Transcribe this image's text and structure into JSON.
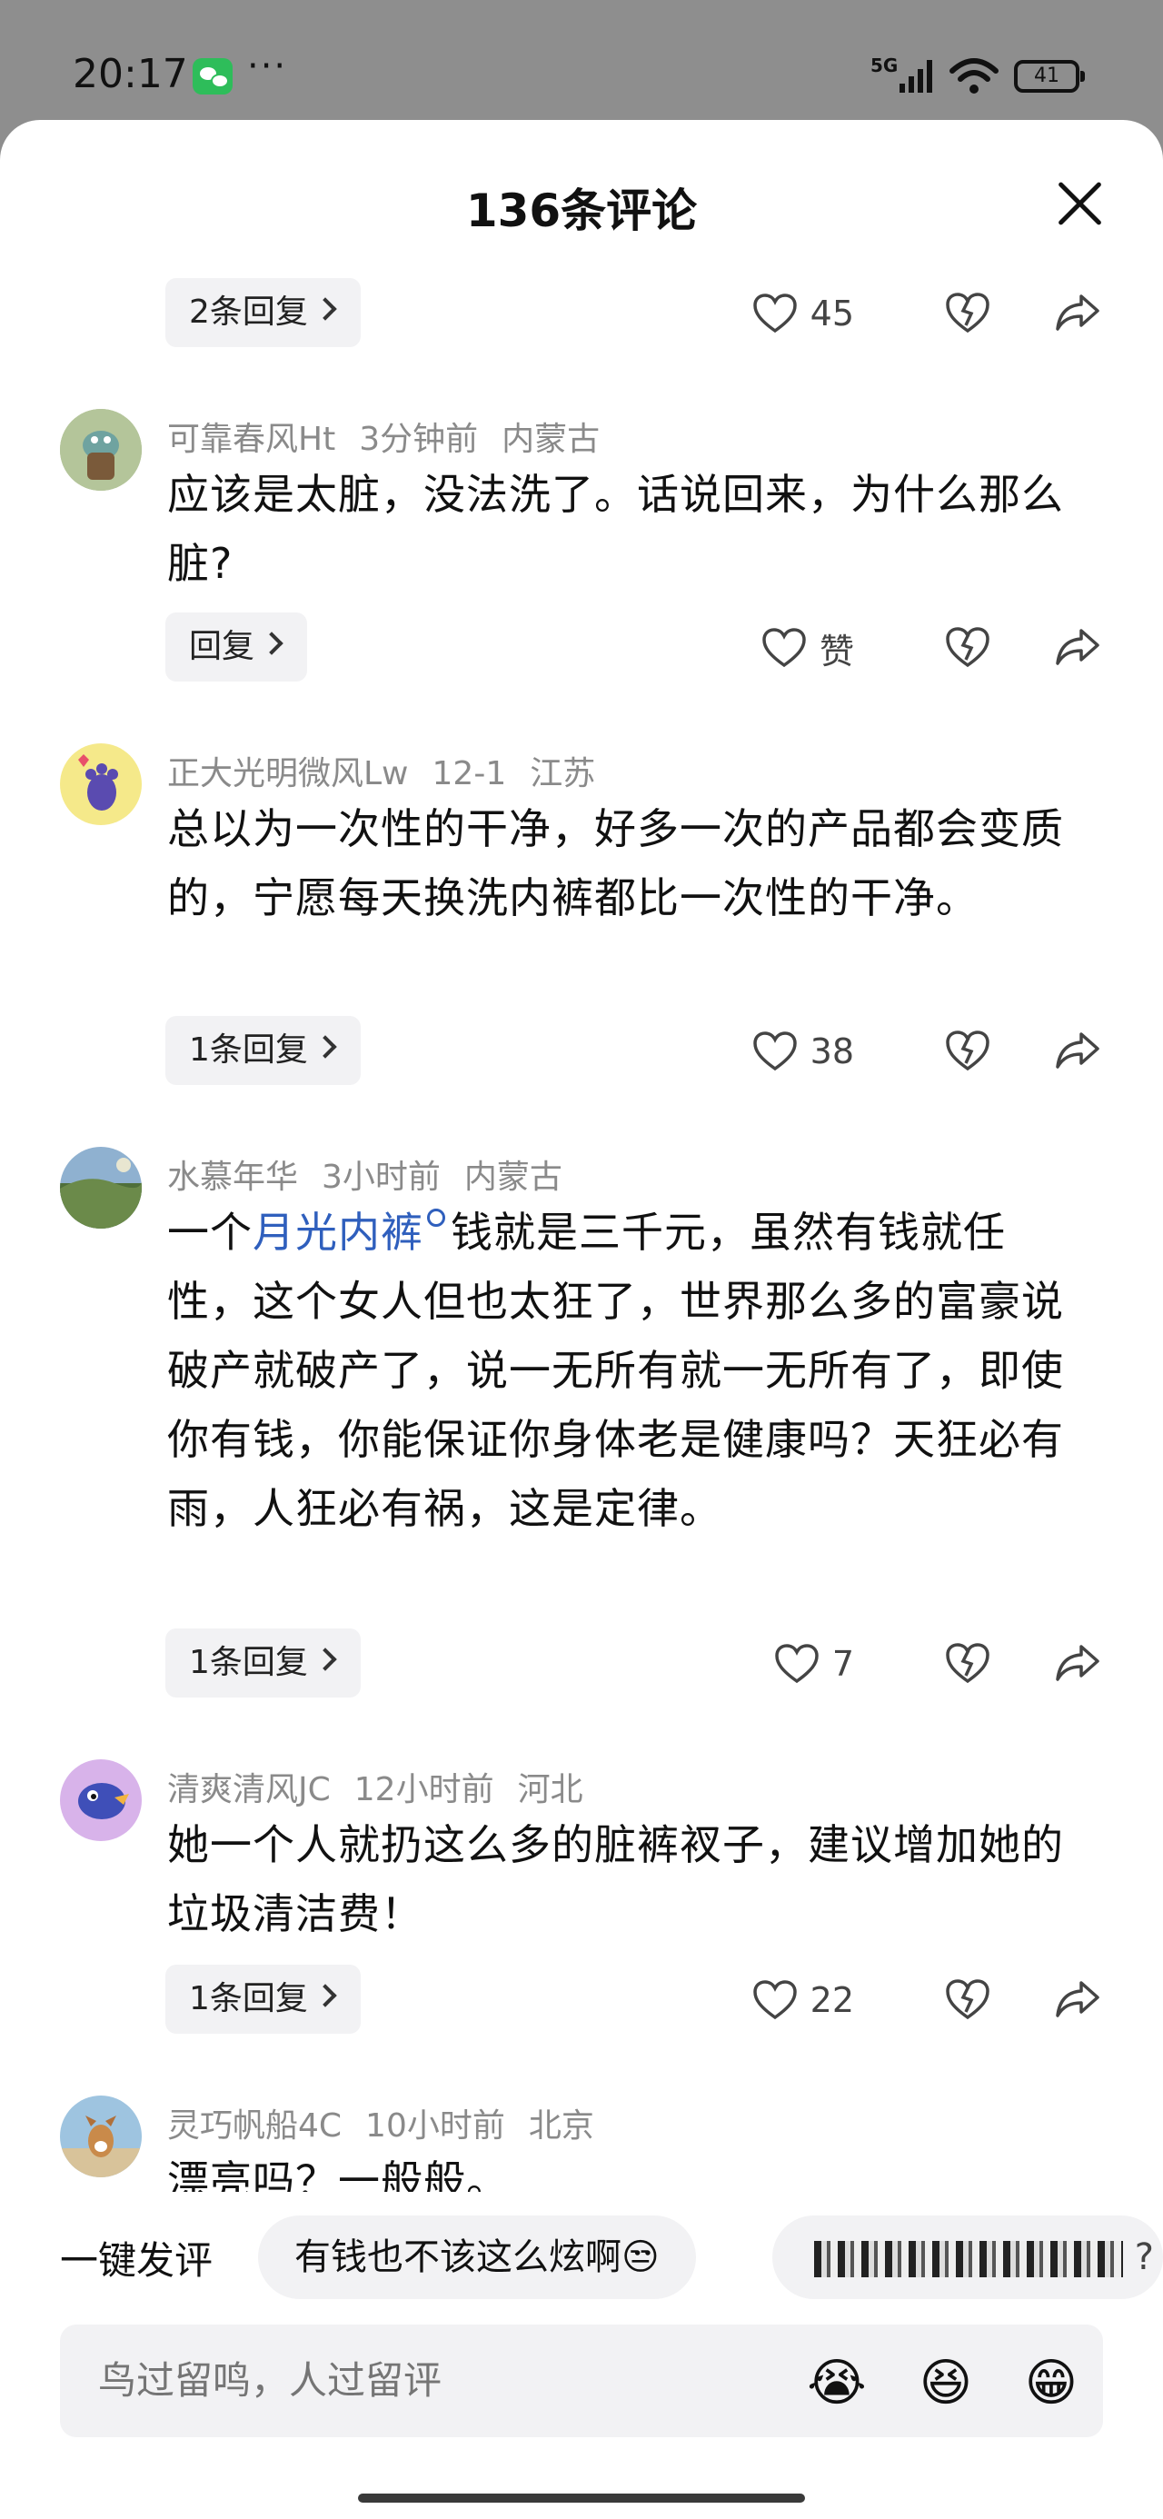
{
  "status_bar": {
    "time": "20:17",
    "dots": "···",
    "network": "5G",
    "battery": "41",
    "icons": [
      "wechat-icon",
      "signal-icon",
      "wifi-icon",
      "battery-icon"
    ]
  },
  "sheet": {
    "title": "136条评论",
    "close_icon": "close-icon"
  },
  "top_row": {
    "reply_label": "2条回复",
    "like_count": "45"
  },
  "comments": [
    {
      "user": "可靠春风Ht",
      "time": "3分钟前",
      "location": "内蒙古",
      "text": "应该是太脏，没法洗了。话说回来，为什么那么脏?",
      "reply_label": "回复",
      "like_count": "赞"
    },
    {
      "user": "正大光明微风Lw",
      "time": "12-1",
      "location": "江苏",
      "text": "总以为一次性的干净，好多一次的产品都会变质的，宁愿每天换洗内裤都比一次性的干净。",
      "reply_label": "1条回复",
      "like_count": "38"
    },
    {
      "user": "水慕年华",
      "time": "3小时前",
      "location": "内蒙古",
      "text_before": "一个",
      "link": "月光内裤",
      "text_after": "钱就是三千元，虽然有钱就任性，这个女人但也太狂了，世界那么多的富豪说破产就破产了，说一无所有就一无所有了，即使你有钱，你能保证你身体老是健康吗？天狂必有雨，人狂必有祸，这是定律。",
      "reply_label": "1条回复",
      "like_count": "7"
    },
    {
      "user": "清爽清风JC",
      "time": "12小时前",
      "location": "河北",
      "text": "她一个人就扔这么多的脏裤衩子，建议增加她的垃圾清洁费！",
      "reply_label": "1条回复",
      "like_count": "22"
    },
    {
      "user": "灵巧帆船4C",
      "time": "10小时前",
      "location": "北京",
      "text": "漂亮吗？一般般。"
    }
  ],
  "quick_comment": {
    "label": "一键发评",
    "chips": [
      "有钱也不该这么炫啊😒",
      "?"
    ]
  },
  "input": {
    "placeholder": "鸟过留鸣，人过留评",
    "emojis": [
      "😭",
      "😆",
      "😁"
    ]
  },
  "colors": {
    "link": "#2f5fbd",
    "chip_bg": "#f2f2f4",
    "meta": "#8a8a8a"
  }
}
